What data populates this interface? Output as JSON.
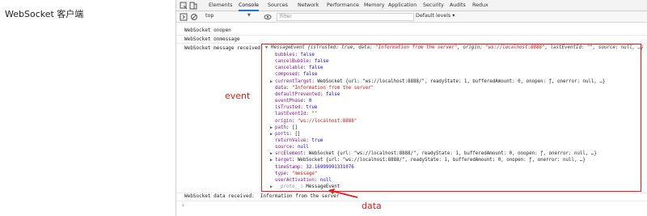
{
  "page": {
    "title": "WebSocket 客户端"
  },
  "devtools": {
    "tabs": [
      "Elements",
      "Console",
      "Sources",
      "Network",
      "Performance",
      "Memory",
      "Application",
      "Security",
      "Audits",
      "Redux"
    ],
    "active_tab": "Console",
    "toolbar": {
      "context": "top",
      "filter_placeholder": "Filter",
      "levels": "Default levels ▾"
    }
  },
  "console": {
    "lines": [
      "WebSocket onopen",
      "WebSocket onmessage"
    ],
    "message_label": "WebSocket message received:",
    "event_header": {
      "prefix": "MessageEvent {isTrusted: true, data: ",
      "data": "\"Information from the server\"",
      "mid": ", origin: ",
      "origin": "\"ws://localhost:8888\"",
      "tail": ", lastEventId: \"\", source: null, …}"
    },
    "props": [
      {
        "key": "bubbles",
        "value": "false",
        "expand": false
      },
      {
        "key": "cancelBubble",
        "value": "false",
        "expand": false
      },
      {
        "key": "cancelable",
        "value": "false",
        "expand": false
      },
      {
        "key": "composed",
        "value": "false",
        "expand": false
      },
      {
        "key": "currentTarget",
        "value": "WebSocket {url: \"ws://localhost:8888/\", readyState: 1, bufferedAmount: 0, onopen: ƒ, onerror: null, …}",
        "expand": true
      },
      {
        "key": "data",
        "value": "\"Information from the server\"",
        "expand": false
      },
      {
        "key": "defaultPrevented",
        "value": "false",
        "expand": false
      },
      {
        "key": "eventPhase",
        "value": "0",
        "expand": false
      },
      {
        "key": "isTrusted",
        "value": "true",
        "expand": false
      },
      {
        "key": "lastEventId",
        "value": "\"\"",
        "expand": false
      },
      {
        "key": "origin",
        "value": "\"ws://localhost:8888\"",
        "expand": false
      },
      {
        "key": "path",
        "value": "[]",
        "expand": true
      },
      {
        "key": "ports",
        "value": "[]",
        "expand": true
      },
      {
        "key": "returnValue",
        "value": "true",
        "expand": false
      },
      {
        "key": "source",
        "value": "null",
        "expand": false
      },
      {
        "key": "srcElement",
        "value": "WebSocket {url: \"ws://localhost:8888/\", readyState: 1, bufferedAmount: 0, onopen: ƒ, onerror: null, …}",
        "expand": true
      },
      {
        "key": "target",
        "value": "WebSocket {url: \"ws://localhost:8888/\", readyState: 1, bufferedAmount: 0, onopen: ƒ, onerror: null, …}",
        "expand": true
      },
      {
        "key": "timeStamp",
        "value": "32.16999991331076",
        "expand": false
      },
      {
        "key": "type",
        "value": "\"message\"",
        "expand": false
      },
      {
        "key": "userActivation",
        "value": "null",
        "expand": false
      },
      {
        "key": "__proto__",
        "value": "MessageEvent",
        "expand": true
      }
    ],
    "data_line": "WebSocket data received:  Information from the server"
  },
  "annotations": {
    "event": "event",
    "data": "data"
  },
  "colors": {
    "annotation": "#e0201b",
    "active_tab": "#1a73e8"
  }
}
